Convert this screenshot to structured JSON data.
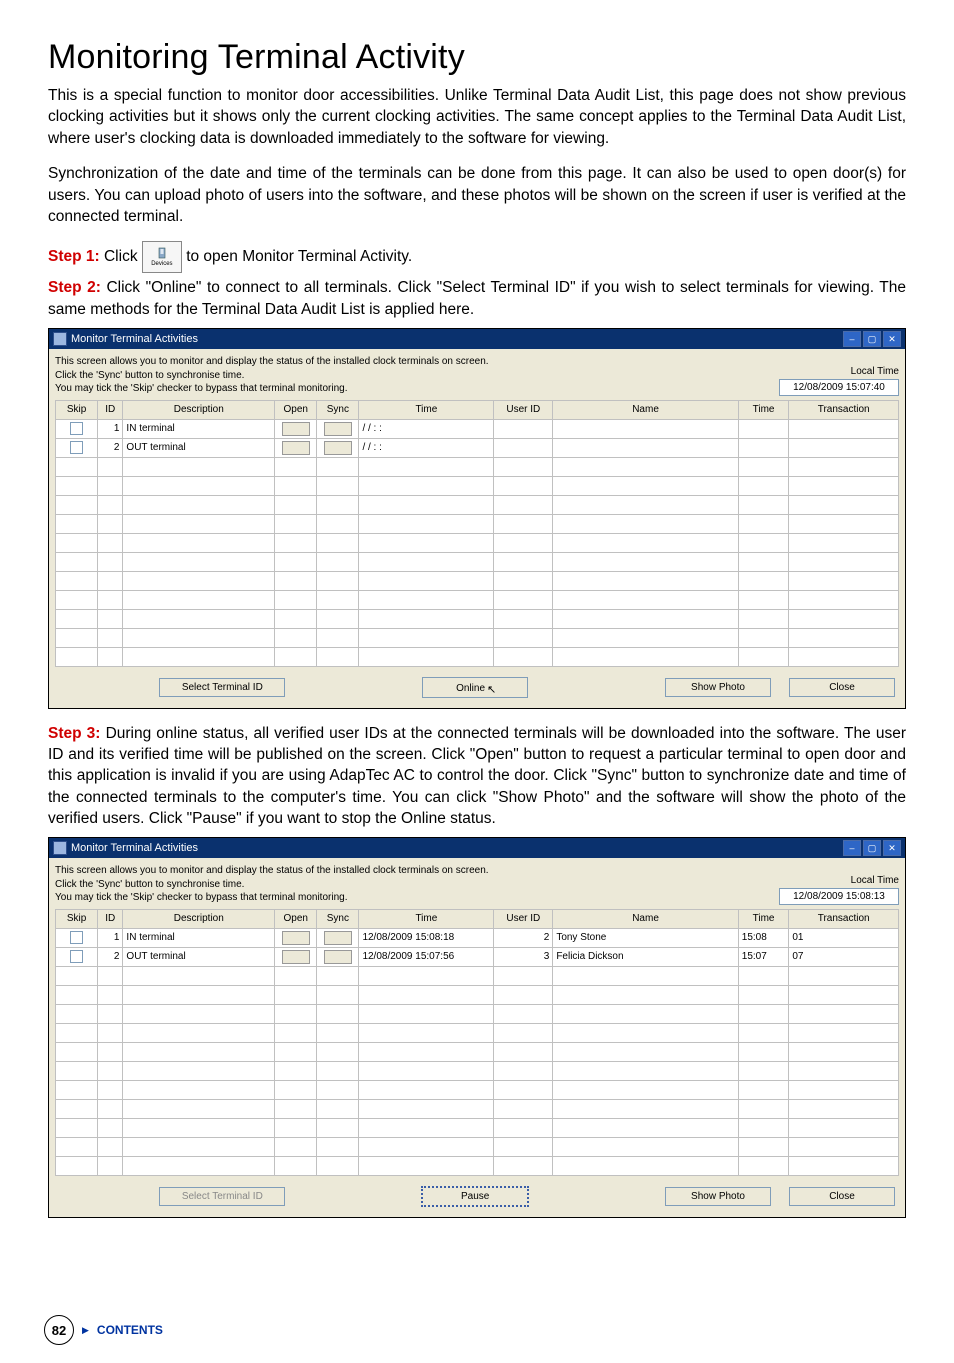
{
  "heading": "Monitoring Terminal Activity",
  "para1": "This is a special function to monitor door accessibilities. Unlike Terminal Data Audit List, this page does not show previous clocking activities but it shows only the current clocking activities. The same concept applies to the Terminal Data Audit List, where user's clocking data is downloaded immediately to the software for viewing.",
  "para2": "Synchronization of the date and time of the terminals can be done from this page. It can also be used to open door(s) for users. You can upload photo of users into the software, and these photos will be shown on the screen if user is verified at the connected terminal.",
  "step1_pre": "Step 1: ",
  "step1_a": "Click ",
  "step1_b": " to open Monitor Terminal Activity.",
  "devices_label": "Devices",
  "step2_pre": "Step 2: ",
  "step2_text": "Click \"Online\" to connect to all terminals. Click \"Select Terminal ID\" if you wish to select terminals for viewing. The same methods for the Terminal Data Audit List is applied here.",
  "step3_pre": "Step 3: ",
  "step3_text": " During online status, all verified user IDs at the connected terminals will be downloaded into the software. The user ID and its verified time will be published on the screen. Click \"Open\" button to request a particular terminal to open door and this application is invalid if you are using AdapTec AC to control the door. Click \"Sync\" button to synchronize date and time of the connected terminals to the computer's time. You can click \"Show Photo\" and the software will show the photo of the verified users. Click \"Pause\" if you want to stop the Online status.",
  "window": {
    "title": "Monitor Terminal Activities",
    "instr1": "This screen allows you to monitor and display the status of the installed clock terminals on screen.",
    "instr2": "Click the 'Sync' button to synchronise time.",
    "instr3": "You may tick the 'Skip' checker to bypass that terminal monitoring.",
    "local_time_label": "Local Time",
    "cols": {
      "skip": "Skip",
      "id": "ID",
      "desc": "Description",
      "open": "Open",
      "sync": "Sync",
      "time": "Time",
      "userid": "User ID",
      "name": "Name",
      "time2": "Time",
      "tx": "Transaction"
    },
    "buttons": {
      "select": "Select Terminal ID",
      "online": "Online",
      "pause": "Pause",
      "show": "Show Photo",
      "close": "Close"
    }
  },
  "win1": {
    "local_time": "12/08/2009 15:07:40",
    "rows": [
      {
        "id": "1",
        "desc": "IN terminal",
        "time": "/  /        :  :"
      },
      {
        "id": "2",
        "desc": "OUT terminal",
        "time": "/  /        :  :"
      }
    ]
  },
  "win2": {
    "local_time": "12/08/2009 15:08:13",
    "rows": [
      {
        "id": "1",
        "desc": "IN terminal",
        "time": "12/08/2009 15:08:18",
        "uid": "2",
        "name": "Tony Stone",
        "t2": "15:08",
        "tx": "01"
      },
      {
        "id": "2",
        "desc": "OUT terminal",
        "time": "12/08/2009 15:07:56",
        "uid": "3",
        "name": "Felicia Dickson",
        "t2": "15:07",
        "tx": "07"
      }
    ]
  },
  "page_number": "82",
  "contents_label": "CONTENTS"
}
